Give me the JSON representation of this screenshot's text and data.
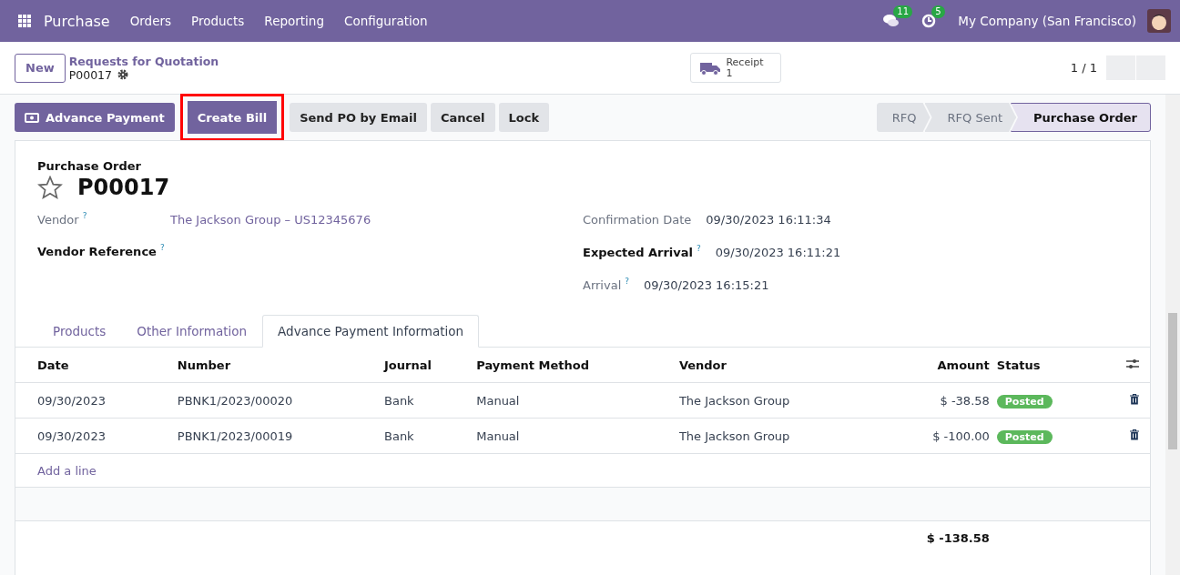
{
  "navbar": {
    "app": "Purchase",
    "menu": [
      "Orders",
      "Products",
      "Reporting",
      "Configuration"
    ],
    "messages_count": "11",
    "activities_count": "5",
    "company": "My Company (San Francisco)"
  },
  "control_panel": {
    "new_button": "New",
    "breadcrumb": "Requests for Quotation",
    "record": "P00017",
    "smart_button": {
      "label": "Receipt",
      "count": "1"
    },
    "pager": "1 / 1"
  },
  "actions": [
    {
      "label": "Advance Payment",
      "kind": "primary",
      "icon": true,
      "highlighted": false
    },
    {
      "label": "Create Bill",
      "kind": "primary",
      "icon": false,
      "highlighted": true
    },
    {
      "label": "Send PO by Email",
      "kind": "secondary",
      "icon": false,
      "highlighted": false
    },
    {
      "label": "Cancel",
      "kind": "secondary",
      "icon": false,
      "highlighted": false
    },
    {
      "label": "Lock",
      "kind": "secondary",
      "icon": false,
      "highlighted": false
    }
  ],
  "statusbar": [
    {
      "label": "RFQ",
      "selected": false
    },
    {
      "label": "RFQ Sent",
      "selected": false
    },
    {
      "label": "Purchase Order",
      "selected": true
    }
  ],
  "form": {
    "subtitle": "Purchase Order",
    "name": "P00017",
    "left_fields": [
      {
        "label": "Vendor",
        "bold": false,
        "value": "The Jackson Group – US12345676"
      },
      {
        "label": "Vendor Reference",
        "bold": true
      }
    ],
    "right_fields": [
      {
        "label": "Confirmation Date",
        "bold": false,
        "help": false,
        "value": "09/30/2023 16:11:34"
      },
      {
        "label": "Expected Arrival",
        "bold": true,
        "help": true,
        "value": "09/30/2023 16:11:21"
      },
      {
        "label": "Arrival",
        "bold": false,
        "help": true,
        "value": "09/30/2023 16:15:21"
      }
    ],
    "help_mark": "?"
  },
  "tabs": [
    {
      "label": "Products",
      "selected": false
    },
    {
      "label": "Other Information",
      "selected": false
    },
    {
      "label": "Advance Payment Information",
      "selected": true
    }
  ],
  "table": {
    "columns": [
      "Date",
      "Number",
      "Journal",
      "Payment Method",
      "Vendor",
      "Amount",
      "Status"
    ],
    "rows": [
      {
        "date": "09/30/2023",
        "number": "PBNK1/2023/00020",
        "journal": "Bank",
        "method": "Manual",
        "vendor": "The Jackson Group",
        "amount": "$ -38.58",
        "status": "Posted"
      },
      {
        "date": "09/30/2023",
        "number": "PBNK1/2023/00019",
        "journal": "Bank",
        "method": "Manual",
        "vendor": "The Jackson Group",
        "amount": "$ -100.00",
        "status": "Posted"
      }
    ],
    "add_line": "Add a line",
    "total": "$ -138.58"
  }
}
